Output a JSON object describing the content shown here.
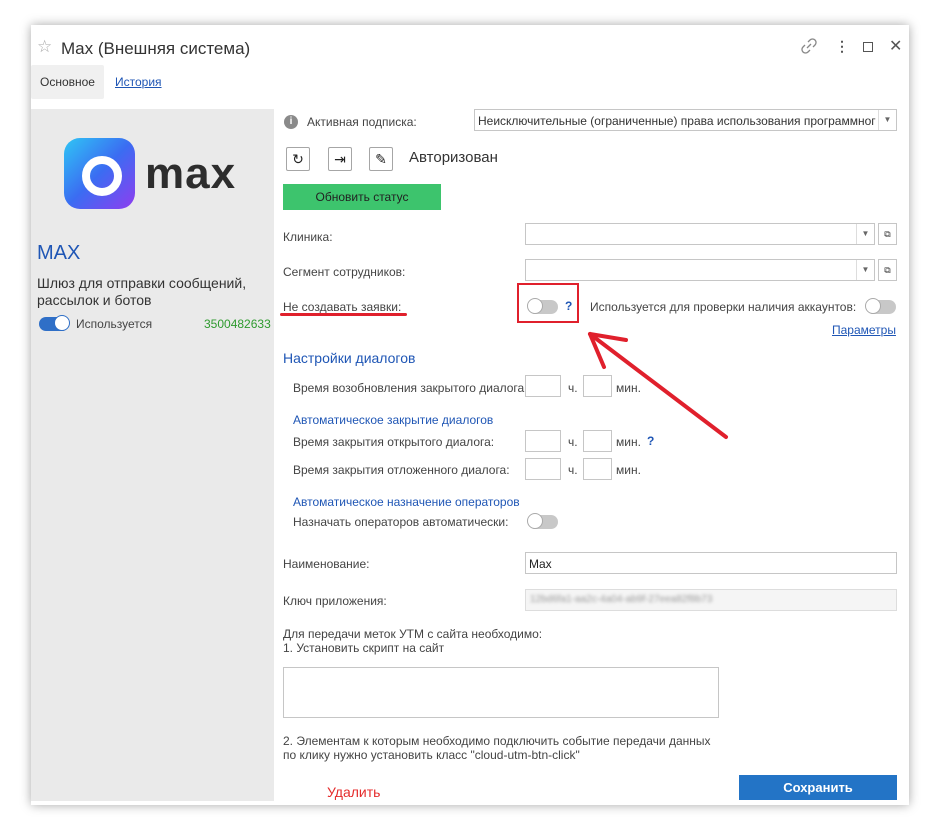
{
  "window": {
    "title": "Max (Внешняя система)"
  },
  "tabs": {
    "main": "Основное",
    "history": "История"
  },
  "sidebar": {
    "logo_text": "max",
    "name": "MAX",
    "description": "Шлюз для отправки сообщений, рассылок и ботов",
    "toggle_label": "Используется",
    "id_value": "3500482633"
  },
  "form": {
    "subscription_label": "Активная подписка:",
    "subscription_value": "Неисключительные (ограниченные) права использования программног",
    "status_text": "Авторизован",
    "update_button": "Обновить статус",
    "clinic_label": "Клиника:",
    "segment_label": "Сегмент сотрудников:",
    "no_requests_label": "Не создавать заявки:",
    "help_mark": "?",
    "accounts_check_label": "Используется для проверки наличия аккаунтов:",
    "params_link": "Параметры",
    "dialog_settings_title": "Настройки диалогов",
    "reopen_time_label": "Время возобновления закрытого диалога:",
    "hours_unit": "ч.",
    "minutes_unit": "мин.",
    "auto_close_title": "Автоматическое закрытие диалогов",
    "open_close_time_label": "Время закрытия открытого диалога:",
    "deferred_close_time_label": "Время закрытия отложенного диалога:",
    "auto_assign_title": "Автоматическое назначение операторов",
    "assign_auto_label": "Назначать операторов автоматически:",
    "name_label": "Наименование:",
    "name_value": "Max",
    "app_key_label": "Ключ приложения:",
    "app_key_value": "12bd6fa1-aa2c-4a04-ab9f-27eea82f8b73",
    "utm_intro": "Для передачи меток УТМ с сайта необходимо:",
    "utm_step1": "1. Установить скрипт на сайт",
    "utm_step2_line1": "2. Элементам к которым необходимо подключить событие передачи данных",
    "utm_step2_line2": "по клику нужно установить класс \"cloud-utm-btn-click\"",
    "save_button": "Сохранить",
    "delete_link": "Удалить"
  },
  "colors": {
    "accent_blue": "#1f56b5",
    "update_green": "#3dc46d",
    "save_blue": "#2374c6",
    "id_green": "#2e9a2e",
    "delete_red": "#e52b2b",
    "annotation_red": "#e0202c"
  },
  "icons": {
    "refresh": "refresh-icon",
    "logout": "logout-icon",
    "clear": "broom-icon",
    "info": "info-icon",
    "link": "link-icon",
    "menu": "more-vertical-icon",
    "maximize": "maximize-icon",
    "close": "close-icon",
    "star": "star-icon"
  }
}
